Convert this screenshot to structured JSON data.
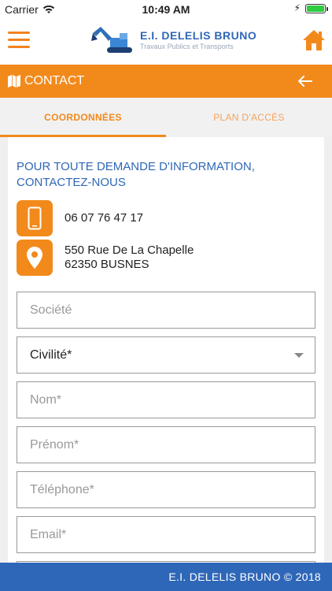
{
  "status_bar": {
    "carrier": "Carrier",
    "time": "10:49 AM"
  },
  "header": {
    "logo_title": "E.I. DELELIS BRUNO",
    "logo_subtitle": "Travaux Publics et Transports",
    "menu_icon": "hamburger-icon",
    "home_icon": "home-icon"
  },
  "section": {
    "title": "CONTACT",
    "icon": "map-icon",
    "back_icon": "arrow-left-icon"
  },
  "tabs": [
    {
      "label": "COORDONNÉES",
      "active": true
    },
    {
      "label": "PLAN D'ACCÈS",
      "active": false
    }
  ],
  "contact": {
    "headline": "POUR TOUTE DEMANDE D'INFORMATION, CONTACTEZ-NOUS",
    "phone": "06 07 76 47 17",
    "address_line1": "550 Rue De La Chapelle",
    "address_line2": "62350 BUSNES"
  },
  "form": {
    "company_placeholder": "Société",
    "civility_value": "Civilité*",
    "name_placeholder": "Nom*",
    "firstname_placeholder": "Prénom*",
    "phone_placeholder": "Téléphone*",
    "email_placeholder": "Email*"
  },
  "footer": {
    "text": "E.I. DELELIS BRUNO © 2018"
  },
  "colors": {
    "accent": "#f28a1b",
    "brand_blue": "#2f67b8"
  }
}
